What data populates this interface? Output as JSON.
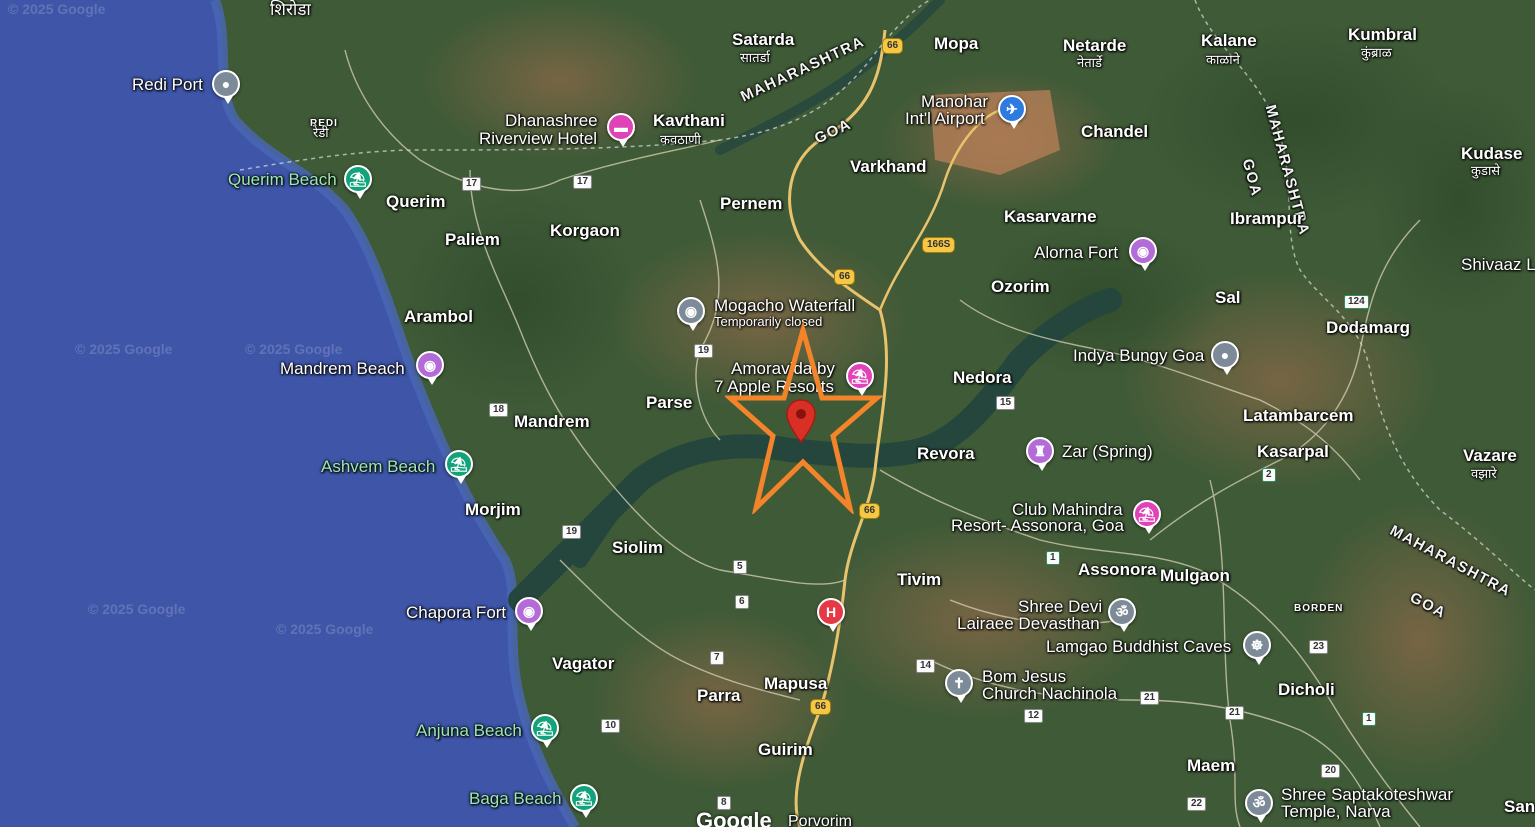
{
  "watermarks": [
    "© 2025 Google",
    "© 2025 Google",
    "© 2025 Google",
    "© 2025 Google",
    "© 2025 Google"
  ],
  "google_logo": "Google",
  "places": {
    "shiroda": "शिरोडा",
    "redi_port": "Redi Port",
    "redi": "REDI",
    "redi_mr": "रेडी",
    "querim_beach": "Querim Beach",
    "querim": "Querim",
    "paliem": "Paliem",
    "korgaon": "Korgaon",
    "arambol": "Arambol",
    "mandrem_beach": "Mandrem Beach",
    "mandrem": "Mandrem",
    "ashvem_beach": "Ashvem Beach",
    "morjim": "Morjim",
    "siolim": "Siolim",
    "chapora_fort": "Chapora Fort",
    "vagator": "Vagator",
    "anjuna_beach": "Anjuna Beach",
    "baga_beach": "Baga Beach",
    "parra": "Parra",
    "mapusa": "Mapusa",
    "guirim": "Guirim",
    "porvorim": "Porvorim",
    "satarda": "Satarda",
    "satarda_mr": "सातर्डा",
    "dhanashree_1": "Dhanashree",
    "dhanashree_2": "Riverview Hotel",
    "kavthani": "Kavthani",
    "kavthani_mr": "कवठाणी",
    "pernem": "Pernem",
    "mogacho": "Mogacho Waterfall",
    "mogacho_status": "Temporarily closed",
    "parse": "Parse",
    "amoravida_1": "Amoravida by",
    "amoravida_2": "7 Apple Resorts",
    "mopa": "Mopa",
    "netarde": "Netarde",
    "netarde_mr": "नेतार्डे",
    "kalane": "Kalane",
    "kalane_mr": "काळाने",
    "kumbral": "Kumbral",
    "kumbral_mr": "कुंब्राळ",
    "manohar_1": "Manohar",
    "manohar_2": "Int'l Airport",
    "varkhand": "Varkhand",
    "chandel": "Chandel",
    "kudase": "Kudase",
    "kudase_mr": "कुडासे",
    "kasarvarne": "Kasarvarne",
    "ibrampur": "Ibrampur",
    "alorna_fort": "Alorna Fort",
    "ozorim": "Ozorim",
    "sal": "Sal",
    "shivaaz": "Shivaaz L",
    "dodamarg": "Dodamarg",
    "indya_bungy": "Indya Bungy Goa",
    "nedora": "Nedora",
    "revora": "Revora",
    "zar": "Zar (Spring)",
    "latambarcem": "Latambarcem",
    "kasarpal": "Kasarpal",
    "vazare": "Vazare",
    "vazare_mr": "वझारे",
    "club_1": "Club Mahindra",
    "club_2": "Resort- Assonora, Goa",
    "assonora": "Assonora",
    "mulgaon": "Mulgaon",
    "tivim": "Tivim",
    "shree_devi_1": "Shree Devi",
    "shree_devi_2": "Lairaee Devasthan",
    "lamgao": "Lamgao Buddhist Caves",
    "bom_jesus_1": "Bom Jesus",
    "bom_jesus_2": "Church Nachinola",
    "dicholi": "Dicholi",
    "maem": "Maem",
    "saptakoteshwar_1": "Shree Saptakoteshwar",
    "saptakoteshwar_2": "Temple, Narva",
    "san": "San",
    "border": "BORDEN"
  },
  "states": {
    "maharashtra_1": "MAHARASHTRA",
    "goa_1": "GOA",
    "maharashtra_2": "MAHARASHTRA",
    "goa_2": "GOA",
    "maharashtra_3": "MAHARASHTRA",
    "goa_3": "GOA"
  },
  "roads": {
    "r17a": "17",
    "r17b": "17",
    "r19a": "19",
    "r18": "18",
    "r19b": "19",
    "r5": "5",
    "r6": "6",
    "r7": "7",
    "r10": "10",
    "r8": "8",
    "r15": "15",
    "r14": "14",
    "r12": "12",
    "r21a": "21",
    "r21b": "21",
    "r23": "23",
    "r20": "20",
    "r22": "22",
    "r1a": "1",
    "r1b": "1",
    "r2": "2",
    "nh66a": "66",
    "nh66b": "66",
    "nh66c": "66",
    "nh66d": "66",
    "nh166s": "166S",
    "nh124": "124"
  },
  "markers": {
    "hospital": "H",
    "selected_pin": "dropped-location-pin",
    "star": "orange-star-annotation"
  },
  "colors": {
    "ocean": "#3e55a8",
    "land": "#3f5a37",
    "star": "#f4842a",
    "pin": "#d93025"
  }
}
